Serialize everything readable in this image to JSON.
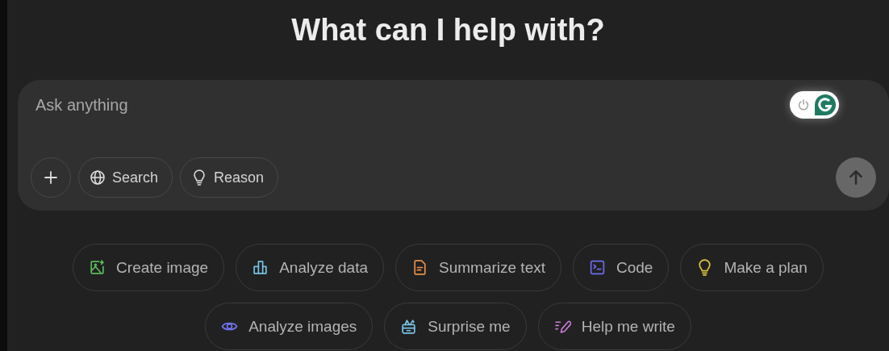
{
  "heading": "What can I help with?",
  "composer": {
    "placeholder": "Ask anything",
    "tools": [
      {
        "kind": "plus"
      },
      {
        "kind": "globe",
        "label": "Search"
      },
      {
        "kind": "bulb",
        "label": "Reason"
      }
    ],
    "send_button": {
      "disabled": true
    },
    "extension_toggle": {
      "on": true
    }
  },
  "suggestions": [
    {
      "kind": "image",
      "label": "Create image",
      "color": "#5bb85b"
    },
    {
      "kind": "chart",
      "label": "Analyze data",
      "color": "#76c4e6"
    },
    {
      "kind": "doc",
      "label": "Summarize text",
      "color": "#e8914a"
    },
    {
      "kind": "code",
      "label": "Code",
      "color": "#6c6cf0"
    },
    {
      "kind": "bulb",
      "label": "Make a plan",
      "color": "#e2c541"
    },
    {
      "kind": "eye",
      "label": "Analyze images",
      "color": "#7272f0"
    },
    {
      "kind": "gift",
      "label": "Surprise me",
      "color": "#76c4e6"
    },
    {
      "kind": "pen",
      "label": "Help me write",
      "color": "#c77ad6"
    }
  ]
}
